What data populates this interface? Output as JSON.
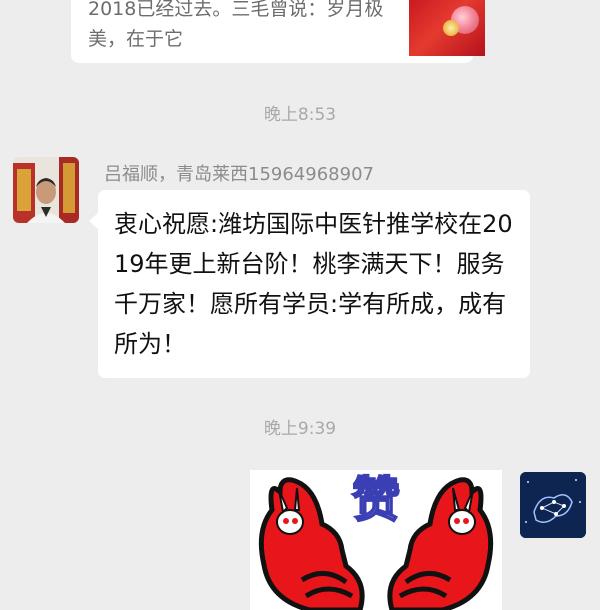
{
  "prev_card": {
    "text": "2018已经过去。三毛曾说：岁月极\n美，在于它"
  },
  "timestamps": [
    "晚上8:53",
    "晚上9:39"
  ],
  "message_in": {
    "sender": "吕福顺，青岛莱西15964968907",
    "text": "衷心祝愿:潍坊国际中医针推学校在2019年更上新台阶！桃李满天下！服务千万家！愿所有学员:学有所成，成有所为！"
  },
  "sticker": {
    "char": "赞"
  },
  "colors": {
    "background": "#ededed",
    "bubble": "#ffffff",
    "timestamp": "#a9a9a9",
    "sender": "#8c8c8c",
    "sticker_red": "#e8161b"
  }
}
